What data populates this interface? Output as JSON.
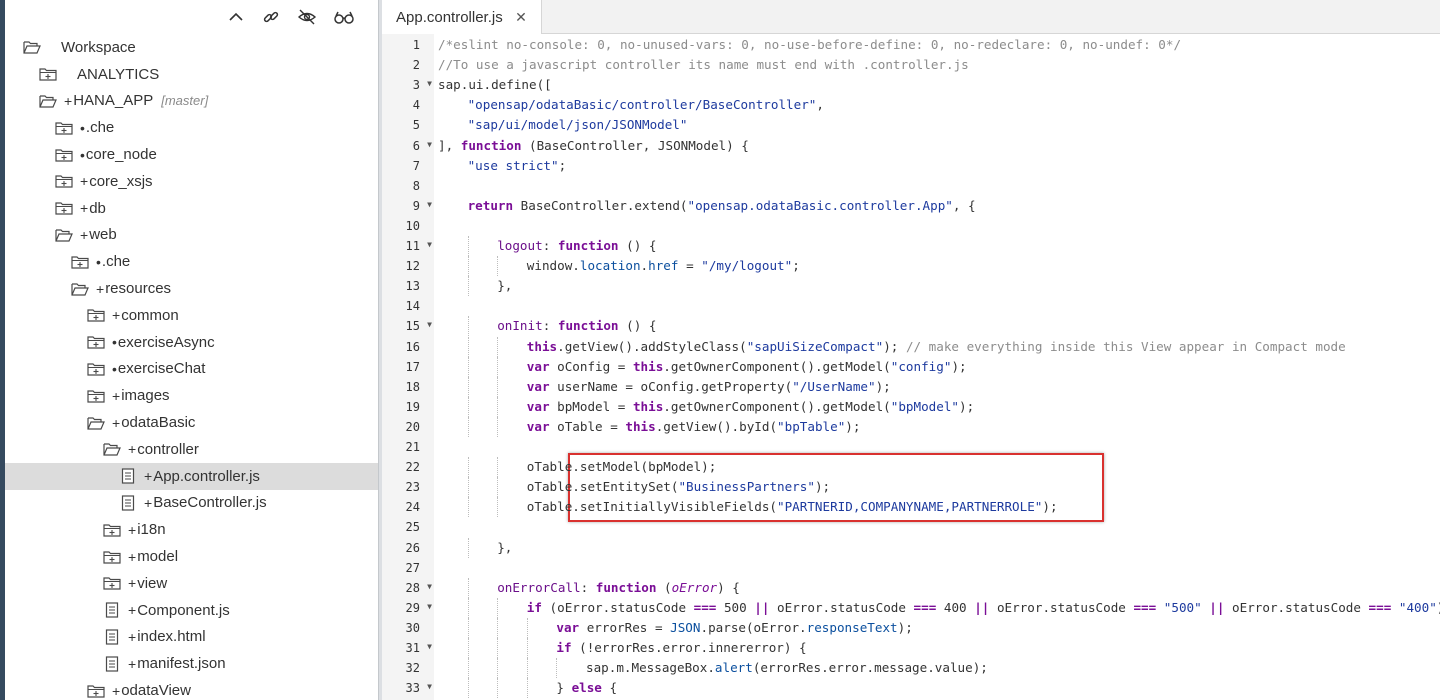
{
  "tree": [
    {
      "label": "Workspace",
      "marker": "",
      "type": "folder-open",
      "depth": 0
    },
    {
      "label": "ANALYTICS",
      "marker": "",
      "type": "folder-closed",
      "depth": 1
    },
    {
      "label": "HANA_APP",
      "marker": "+",
      "type": "folder-open",
      "depth": 1,
      "branch": "[master]"
    },
    {
      "label": ".che",
      "marker": "•",
      "type": "folder-closed",
      "depth": 2
    },
    {
      "label": "core_node",
      "marker": "•",
      "type": "folder-closed",
      "depth": 2
    },
    {
      "label": "core_xsjs",
      "marker": "+",
      "type": "folder-closed",
      "depth": 2
    },
    {
      "label": "db",
      "marker": "+",
      "type": "folder-closed",
      "depth": 2
    },
    {
      "label": "web",
      "marker": "+",
      "type": "folder-open",
      "depth": 2
    },
    {
      "label": ".che",
      "marker": "•",
      "type": "folder-closed",
      "depth": 3
    },
    {
      "label": "resources",
      "marker": "+",
      "type": "folder-open",
      "depth": 3
    },
    {
      "label": "common",
      "marker": "+",
      "type": "folder-closed",
      "depth": 4
    },
    {
      "label": "exerciseAsync",
      "marker": "•",
      "type": "folder-closed",
      "depth": 4
    },
    {
      "label": "exerciseChat",
      "marker": "•",
      "type": "folder-closed",
      "depth": 4
    },
    {
      "label": "images",
      "marker": "+",
      "type": "folder-closed",
      "depth": 4
    },
    {
      "label": "odataBasic",
      "marker": "+",
      "type": "folder-open",
      "depth": 4
    },
    {
      "label": "controller",
      "marker": "+",
      "type": "folder-open",
      "depth": 5
    },
    {
      "label": "App.controller.js",
      "marker": "+",
      "type": "file",
      "depth": 6,
      "selected": true
    },
    {
      "label": "BaseController.js",
      "marker": "+",
      "type": "file",
      "depth": 6
    },
    {
      "label": "i18n",
      "marker": "+",
      "type": "folder-closed",
      "depth": 5
    },
    {
      "label": "model",
      "marker": "+",
      "type": "folder-closed",
      "depth": 5
    },
    {
      "label": "view",
      "marker": "+",
      "type": "folder-closed",
      "depth": 5
    },
    {
      "label": "Component.js",
      "marker": "+",
      "type": "file",
      "depth": 5
    },
    {
      "label": "index.html",
      "marker": "+",
      "type": "file",
      "depth": 5
    },
    {
      "label": "manifest.json",
      "marker": "+",
      "type": "file",
      "depth": 5
    },
    {
      "label": "odataView",
      "marker": "+",
      "type": "folder-closed",
      "depth": 4
    }
  ],
  "toolbar": {
    "icons": [
      "collapse-all-icon",
      "link-with-editor-icon",
      "hide-hidden-files-icon",
      "glasses-icon"
    ]
  },
  "tab": {
    "label": "App.controller.js",
    "close_glyph": "✕"
  },
  "code": [
    {
      "n": 1,
      "indent": 0,
      "fold": false,
      "t": [
        [
          "c",
          "/*eslint no-console: 0, no-unused-vars: 0, no-use-before-define: 0, no-redeclare: 0, no-undef: 0*/"
        ]
      ]
    },
    {
      "n": 2,
      "indent": 0,
      "fold": false,
      "t": [
        [
          "c",
          "//To use a javascript controller its name must end with .controller.js"
        ]
      ]
    },
    {
      "n": 3,
      "indent": 0,
      "fold": true,
      "t": [
        [
          "",
          "sap.ui.define(["
        ]
      ]
    },
    {
      "n": 4,
      "indent": 1,
      "fold": false,
      "t": [
        [
          "s",
          "\"opensap/odataBasic/controller/BaseController\""
        ],
        [
          "",
          ","
        ]
      ]
    },
    {
      "n": 5,
      "indent": 1,
      "fold": false,
      "t": [
        [
          "s",
          "\"sap/ui/model/json/JSONModel\""
        ]
      ]
    },
    {
      "n": 6,
      "indent": 0,
      "fold": true,
      "t": [
        [
          "",
          "], "
        ],
        [
          "k",
          "function"
        ],
        [
          "",
          " (BaseController, JSONModel) {"
        ]
      ]
    },
    {
      "n": 7,
      "indent": 1,
      "fold": false,
      "t": [
        [
          "s",
          "\"use strict\""
        ],
        [
          "",
          ";"
        ]
      ]
    },
    {
      "n": 8,
      "indent": 0,
      "fold": false,
      "t": []
    },
    {
      "n": 9,
      "indent": 1,
      "fold": true,
      "t": [
        [
          "k",
          "return"
        ],
        [
          "",
          " BaseController.extend("
        ],
        [
          "s",
          "\"opensap.odataBasic.controller.App\""
        ],
        [
          "",
          ", {"
        ]
      ]
    },
    {
      "n": 10,
      "indent": 0,
      "fold": false,
      "t": []
    },
    {
      "n": 11,
      "indent": 2,
      "fold": true,
      "t": [
        [
          "prop",
          "logout"
        ],
        [
          "",
          ": "
        ],
        [
          "k",
          "function"
        ],
        [
          "",
          " () {"
        ]
      ]
    },
    {
      "n": 12,
      "indent": 3,
      "fold": false,
      "t": [
        [
          "",
          "window."
        ],
        [
          "p",
          "location"
        ],
        [
          "",
          "."
        ],
        [
          "p",
          "href"
        ],
        [
          "",
          " = "
        ],
        [
          "s",
          "\"/my/logout\""
        ],
        [
          "",
          ";"
        ]
      ]
    },
    {
      "n": 13,
      "indent": 2,
      "fold": false,
      "t": [
        [
          "",
          "},"
        ]
      ]
    },
    {
      "n": 14,
      "indent": 0,
      "fold": false,
      "t": []
    },
    {
      "n": 15,
      "indent": 2,
      "fold": true,
      "t": [
        [
          "prop",
          "onInit"
        ],
        [
          "",
          ": "
        ],
        [
          "k",
          "function"
        ],
        [
          "",
          " () {"
        ]
      ]
    },
    {
      "n": 16,
      "indent": 3,
      "fold": false,
      "t": [
        [
          "k",
          "this"
        ],
        [
          "",
          ".getView().addStyleClass("
        ],
        [
          "s",
          "\"sapUiSizeCompact\""
        ],
        [
          "",
          "); "
        ],
        [
          "c",
          "// make everything inside this View appear in Compact mode"
        ]
      ]
    },
    {
      "n": 17,
      "indent": 3,
      "fold": false,
      "t": [
        [
          "k",
          "var"
        ],
        [
          "",
          " oConfig = "
        ],
        [
          "k",
          "this"
        ],
        [
          "",
          ".getOwnerComponent().getModel("
        ],
        [
          "s",
          "\"config\""
        ],
        [
          "",
          ");"
        ]
      ]
    },
    {
      "n": 18,
      "indent": 3,
      "fold": false,
      "t": [
        [
          "k",
          "var"
        ],
        [
          "",
          " userName = oConfig.getProperty("
        ],
        [
          "s",
          "\"/UserName\""
        ],
        [
          "",
          ");"
        ]
      ]
    },
    {
      "n": 19,
      "indent": 3,
      "fold": false,
      "t": [
        [
          "k",
          "var"
        ],
        [
          "",
          " bpModel = "
        ],
        [
          "k",
          "this"
        ],
        [
          "",
          ".getOwnerComponent().getModel("
        ],
        [
          "s",
          "\"bpModel\""
        ],
        [
          "",
          ");"
        ]
      ]
    },
    {
      "n": 20,
      "indent": 3,
      "fold": false,
      "t": [
        [
          "k",
          "var"
        ],
        [
          "",
          " oTable = "
        ],
        [
          "k",
          "this"
        ],
        [
          "",
          ".getView().byId("
        ],
        [
          "s",
          "\"bpTable\""
        ],
        [
          "",
          ");"
        ]
      ]
    },
    {
      "n": 21,
      "indent": 0,
      "fold": false,
      "t": []
    },
    {
      "n": 22,
      "indent": 3,
      "fold": false,
      "t": [
        [
          "",
          "oTable.setModel(bpModel);"
        ]
      ]
    },
    {
      "n": 23,
      "indent": 3,
      "fold": false,
      "t": [
        [
          "",
          "oTable.setEntitySet("
        ],
        [
          "s",
          "\"BusinessPartners\""
        ],
        [
          "",
          ");"
        ]
      ]
    },
    {
      "n": 24,
      "indent": 3,
      "fold": false,
      "t": [
        [
          "",
          "oTable.setInitiallyVisibleFields("
        ],
        [
          "s",
          "\"PARTNERID,COMPANYNAME,PARTNERROLE\""
        ],
        [
          "",
          ");"
        ]
      ]
    },
    {
      "n": 25,
      "indent": 0,
      "fold": false,
      "t": []
    },
    {
      "n": 26,
      "indent": 2,
      "fold": false,
      "t": [
        [
          "",
          "},"
        ]
      ]
    },
    {
      "n": 27,
      "indent": 0,
      "fold": false,
      "t": []
    },
    {
      "n": 28,
      "indent": 2,
      "fold": true,
      "t": [
        [
          "prop",
          "onErrorCall"
        ],
        [
          "",
          ": "
        ],
        [
          "k",
          "function"
        ],
        [
          "",
          " ("
        ],
        [
          "it",
          "oError"
        ],
        [
          "",
          ") {"
        ]
      ]
    },
    {
      "n": 29,
      "indent": 3,
      "fold": true,
      "t": [
        [
          "k",
          "if"
        ],
        [
          "",
          " (oError.statusCode "
        ],
        [
          "k",
          "==="
        ],
        [
          "",
          " 500 "
        ],
        [
          "k",
          "||"
        ],
        [
          "",
          " oError.statusCode "
        ],
        [
          "k",
          "==="
        ],
        [
          "",
          " 400 "
        ],
        [
          "k",
          "||"
        ],
        [
          "",
          " oError.statusCode "
        ],
        [
          "k",
          "==="
        ],
        [
          "",
          " "
        ],
        [
          "s",
          "\"500\""
        ],
        [
          "",
          " "
        ],
        [
          "k",
          "||"
        ],
        [
          "",
          " oError.statusCode "
        ],
        [
          "k",
          "==="
        ],
        [
          "",
          " "
        ],
        [
          "s",
          "\"400\""
        ],
        [
          "",
          ") {"
        ]
      ]
    },
    {
      "n": 30,
      "indent": 4,
      "fold": false,
      "t": [
        [
          "k",
          "var"
        ],
        [
          "",
          " errorRes = "
        ],
        [
          "p",
          "JSON"
        ],
        [
          "",
          ".parse(oError."
        ],
        [
          "p",
          "responseText"
        ],
        [
          "",
          ");"
        ]
      ]
    },
    {
      "n": 31,
      "indent": 4,
      "fold": true,
      "t": [
        [
          "k",
          "if"
        ],
        [
          "",
          " (!errorRes.error.innererror) {"
        ]
      ]
    },
    {
      "n": 32,
      "indent": 5,
      "fold": false,
      "t": [
        [
          "",
          "sap.m.MessageBox."
        ],
        [
          "p",
          "alert"
        ],
        [
          "",
          "(errorRes.error.message.value);"
        ]
      ]
    },
    {
      "n": 33,
      "indent": 4,
      "fold": true,
      "t": [
        [
          "",
          "} "
        ],
        [
          "k",
          "else"
        ],
        [
          "",
          " {"
        ]
      ]
    }
  ]
}
